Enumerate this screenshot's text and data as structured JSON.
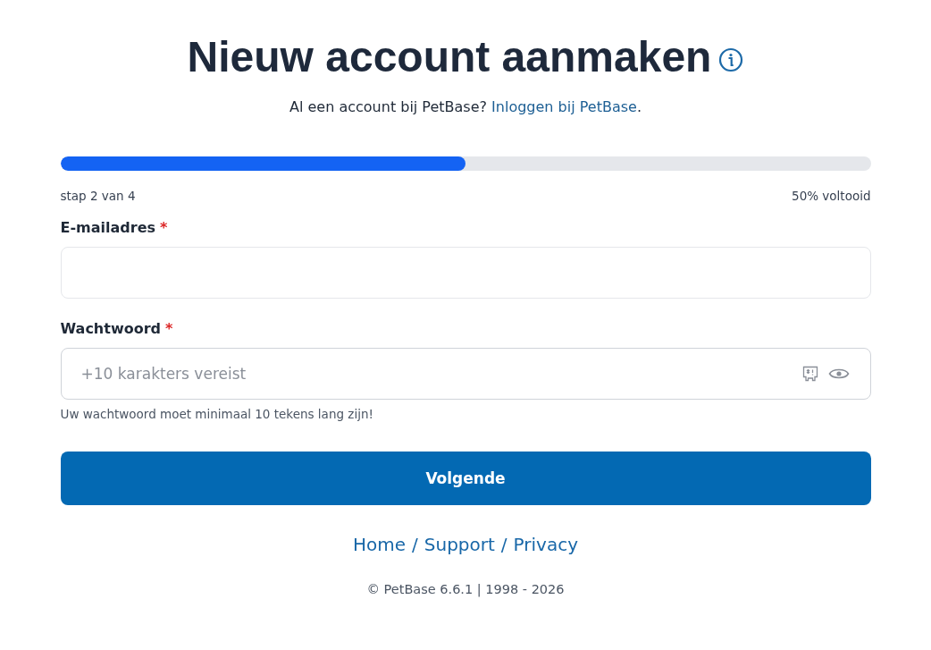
{
  "title": "Nieuw account aanmaken",
  "subtitle": {
    "text": "Al een account bij PetBase?",
    "link": "Inloggen bij PetBase",
    "after": "."
  },
  "progress": {
    "level": 0.5,
    "step": "stap 2 van 4",
    "percent": "50% voltooid"
  },
  "fields": [
    {
      "label": "E-mailadres",
      "required": "*",
      "kind": "email"
    },
    {
      "label": "Wachtwoord",
      "required": "*",
      "kind": "password",
      "placeholder": "+10 karakters vereist",
      "hint": "Uw wachtwoord moet minimaal 10 tekens lang zijn!"
    }
  ],
  "submit": "Volgende",
  "footer_links": [
    {
      "label": "Home"
    },
    {
      "label": "Support"
    },
    {
      "label": "Privacy"
    }
  ],
  "footer_separator": "/",
  "copyright": "© PetBase 6.6.1 | 1998 - 2026"
}
